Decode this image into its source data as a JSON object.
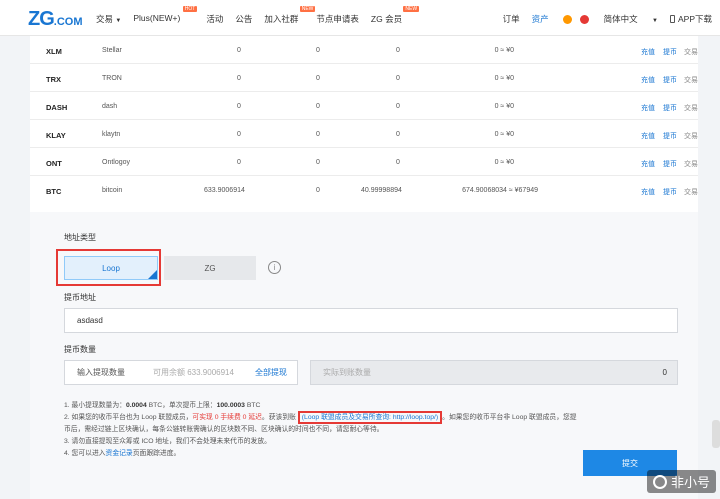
{
  "header": {
    "logo": "ZG",
    "logo_suffix": ".COM",
    "nav": [
      {
        "label": "交易",
        "caret": "▼",
        "badge": ""
      },
      {
        "label": "Plus(NEW+)",
        "caret": "",
        "badge": "HOT"
      },
      {
        "label": "活动",
        "caret": "",
        "badge": ""
      },
      {
        "label": "公告",
        "caret": "",
        "badge": ""
      },
      {
        "label": "加入社群",
        "caret": "",
        "badge": "NEW"
      },
      {
        "label": "节点申请表",
        "caret": "",
        "badge": ""
      },
      {
        "label": "ZG 会员",
        "caret": "",
        "badge": "NEW"
      }
    ],
    "orders": "订单",
    "assets": "资产",
    "language": "简体中文",
    "language_caret": "▼",
    "app_download": "APP下载"
  },
  "table": {
    "rows": [
      {
        "symbol": "XLM",
        "name": "Stellar",
        "available": "0",
        "frozen": "0",
        "locked": "0",
        "total": "0 ≈ ¥0",
        "deposit": "充值",
        "withdraw": "提币",
        "trade": "交易"
      },
      {
        "symbol": "TRX",
        "name": "TRON",
        "available": "0",
        "frozen": "0",
        "locked": "0",
        "total": "0 ≈ ¥0",
        "deposit": "充值",
        "withdraw": "提币",
        "trade": "交易"
      },
      {
        "symbol": "DASH",
        "name": "dash",
        "available": "0",
        "frozen": "0",
        "locked": "0",
        "total": "0 ≈ ¥0",
        "deposit": "充值",
        "withdraw": "提币",
        "trade": "交易"
      },
      {
        "symbol": "KLAY",
        "name": "klaytn",
        "available": "0",
        "frozen": "0",
        "locked": "0",
        "total": "0 ≈ ¥0",
        "deposit": "充值",
        "withdraw": "提币",
        "trade": "交易"
      },
      {
        "symbol": "ONT",
        "name": "Ontlogoy",
        "available": "0",
        "frozen": "0",
        "locked": "0",
        "total": "0 ≈ ¥0",
        "deposit": "充值",
        "withdraw": "提币",
        "trade": "交易"
      },
      {
        "symbol": "BTC",
        "name": "bitcoin",
        "available": "633.9006914",
        "frozen": "0",
        "locked": "40.99998894",
        "total": "674.90068034 ≈ ¥67949",
        "deposit": "充值",
        "withdraw": "提币",
        "trade": "交易"
      }
    ]
  },
  "withdraw_form": {
    "address_type_label": "地址类型",
    "tab_loop": "Loop",
    "tab_zg": "ZG",
    "info_glyph": "i",
    "address_label": "提币地址",
    "address_value": "asdasd",
    "amount_label": "提币数量",
    "amount_placeholder": "输入提现数量",
    "available_text": "可用余额 633.9006914",
    "withdraw_all": "全部提现",
    "receive_placeholder": "实际到账数量",
    "receive_value": "0",
    "notes": {
      "n1_pre": "1. 最小提现数量为：",
      "n1_min": "0.0004",
      "n1_mid": " BTC，单次提币上限：",
      "n1_max": "100.0003",
      "n1_end": " BTC",
      "n2_pre": "2. 如果您的收币平台也为 Loop 联盟成员，",
      "n2_red": "可实现 0 手续费 0 延迟",
      "n2_mid": "。获该到账 ",
      "n2_link": "(Loop 联盟成员及交易所查询: http://loop.top/)",
      "n2_end": "。如果您的收币平台非 Loop 联盟成员，您提",
      "n2_line2": "币后，需经过链上区块确认，每条公链转账需确认的区块数不同、区块确认的时间也不同，请您耐心等待。",
      "n3": "3. 请勿直接提现至众筹或 ICO 地址，我们不会处理未来代币的发放。",
      "n4_pre": "4. 您可以进入",
      "n4_link": "资金记录",
      "n4_end": "页面跟踪进度。"
    },
    "submit": "提交"
  },
  "watermark": "非小号"
}
